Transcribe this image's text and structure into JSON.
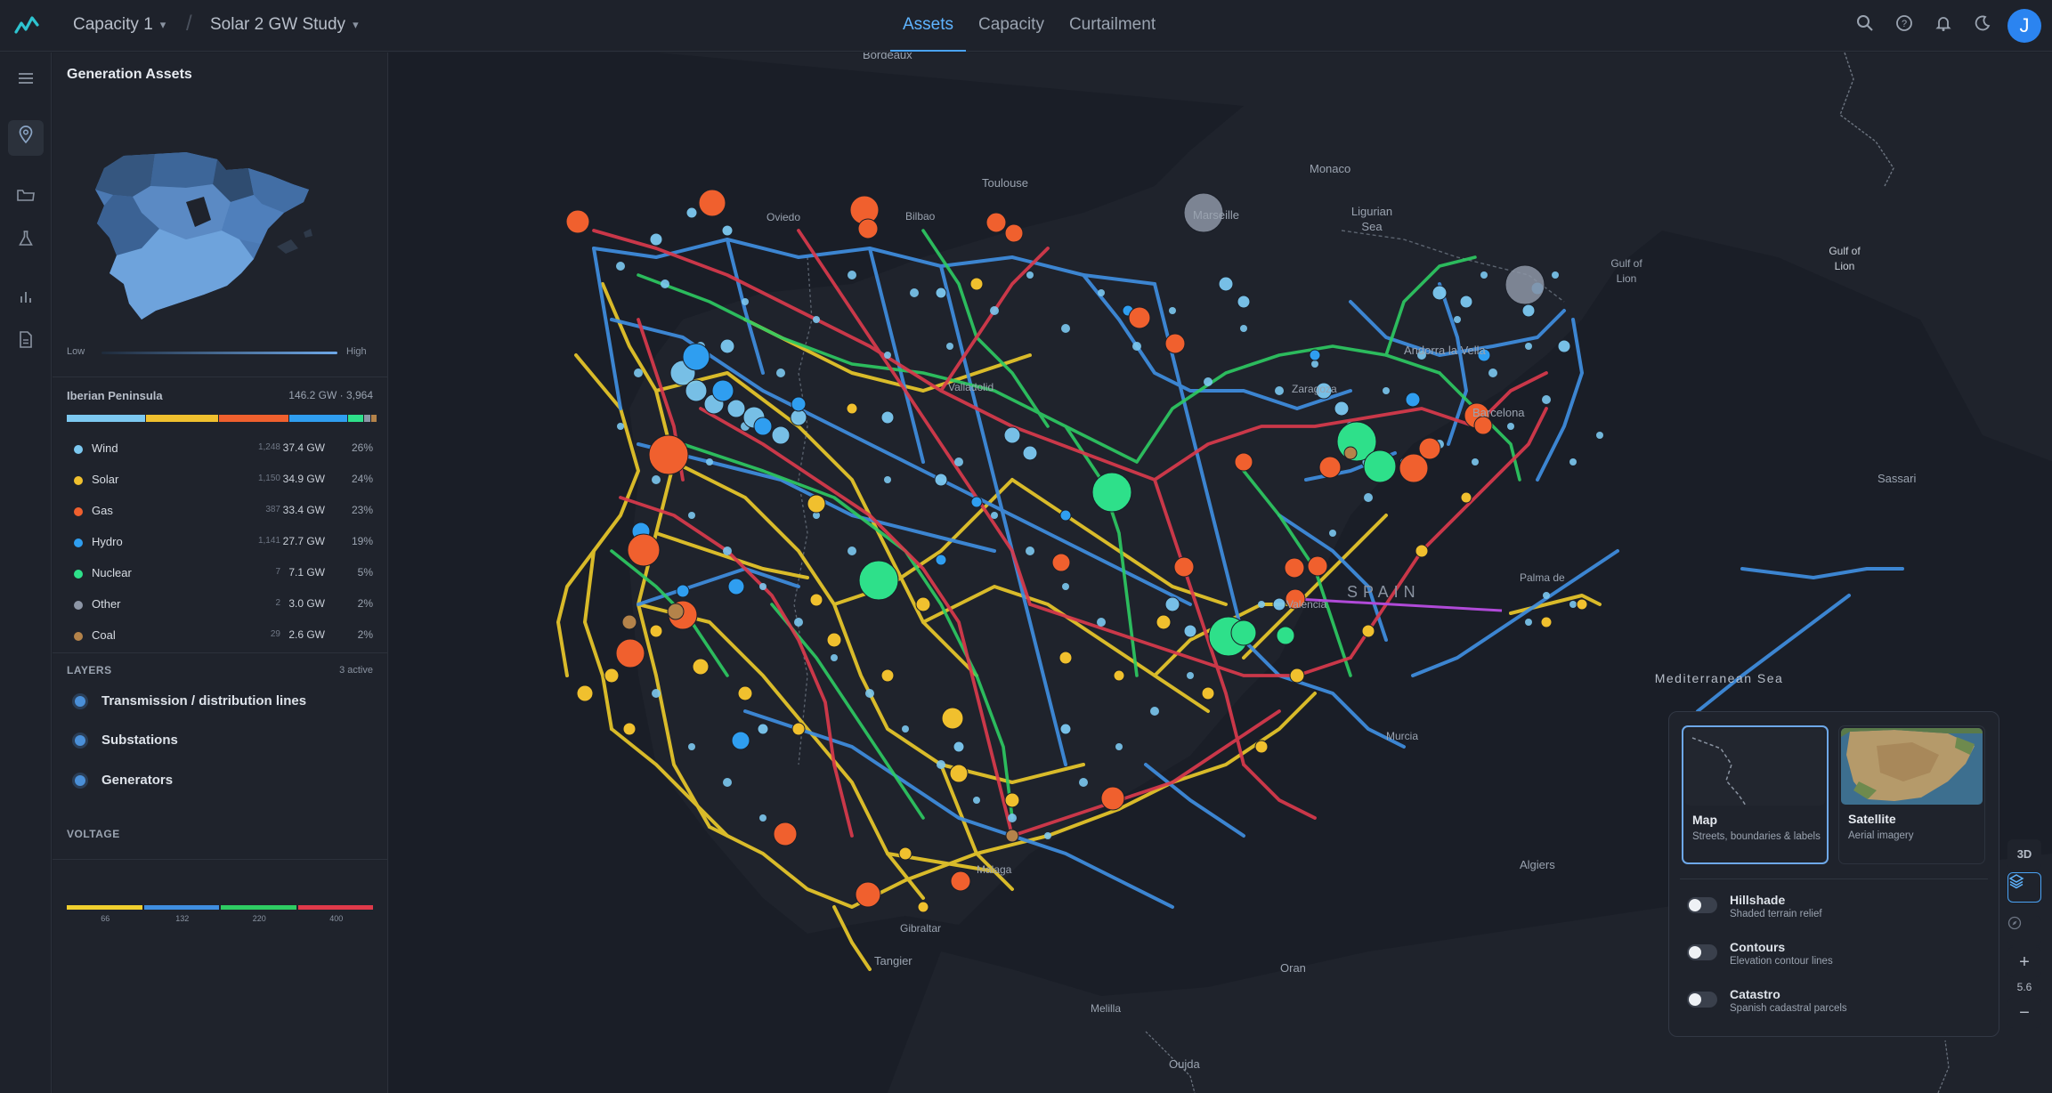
{
  "topbar": {
    "project": "Capacity 1",
    "study": "Solar 2 GW Study",
    "tabs": [
      {
        "label": "Assets",
        "active": true
      },
      {
        "label": "Capacity",
        "active": false
      },
      {
        "label": "Curtailment",
        "active": false
      }
    ],
    "avatar_initial": "J"
  },
  "panel": {
    "title": "Generation Assets",
    "minimap_legend": {
      "low": "Low",
      "high": "High"
    },
    "region": {
      "name": "Iberian Peninsula",
      "total": "146.2 GW · 3,964"
    },
    "fuels": [
      {
        "name": "Wind",
        "count": "1,248",
        "gw": "37.4 GW",
        "pct": "26%",
        "color": "#7cc8f0"
      },
      {
        "name": "Solar",
        "count": "1,150",
        "gw": "34.9 GW",
        "pct": "24%",
        "color": "#f0c02e"
      },
      {
        "name": "Gas",
        "count": "387",
        "gw": "33.4 GW",
        "pct": "23%",
        "color": "#f0602e"
      },
      {
        "name": "Hydro",
        "count": "1,141",
        "gw": "27.7 GW",
        "pct": "19%",
        "color": "#2f9ef0"
      },
      {
        "name": "Nuclear",
        "count": "7",
        "gw": "7.1 GW",
        "pct": "5%",
        "color": "#2ee08a"
      },
      {
        "name": "Other",
        "count": "2",
        "gw": "3.0 GW",
        "pct": "2%",
        "color": "#8d96a6"
      },
      {
        "name": "Coal",
        "count": "29",
        "gw": "2.6 GW",
        "pct": "2%",
        "color": "#b4834a"
      }
    ],
    "layers": {
      "heading": "LAYERS",
      "active": "3 active",
      "items": [
        "Transmission / distribution lines",
        "Substations",
        "Generators"
      ]
    },
    "voltage": {
      "heading": "VOLTAGE",
      "levels": [
        {
          "kv": "66",
          "color": "#f0cf2e"
        },
        {
          "kv": "132",
          "color": "#3f8ee0"
        },
        {
          "kv": "220",
          "color": "#2ecc63"
        },
        {
          "kv": "400",
          "color": "#e03a4a"
        }
      ]
    }
  },
  "map": {
    "places": {
      "bordeaux": "Bordeaux",
      "toulouse": "Toulouse",
      "marseille": "Marseille",
      "monaco": "Monaco",
      "ligurian": "Ligurian Sea",
      "gulf": "Gulf of Lion",
      "andorra": "Andorra la Vella",
      "barcelona": "Barcelona",
      "bilbao": "Bilbao",
      "valladolid": "Valladolid",
      "zaragoza": "Zaragoza",
      "spain": "SPAIN",
      "valencia": "Valencia",
      "palma": "Palma de",
      "sassari": "Sassari",
      "mediterranean": "Mediterranean Sea",
      "algiers": "Algiers",
      "oran": "Oran",
      "malaga": "Malaga",
      "gibraltar": "Gibraltar",
      "tangier": "Tangier",
      "melilla": "Melilla",
      "oujda": "Oujda",
      "oviedo": "Oviedo",
      "murcia": "Murcia"
    },
    "basemap": {
      "options": [
        {
          "title": "Map",
          "subtitle": "Streets, boundaries & labels",
          "selected": true
        },
        {
          "title": "Satellite",
          "subtitle": "Aerial imagery",
          "selected": false
        }
      ],
      "overlays": [
        {
          "title": "Hillshade",
          "subtitle": "Shaded terrain relief",
          "on": false
        },
        {
          "title": "Contours",
          "subtitle": "Elevation contour lines",
          "on": false
        },
        {
          "title": "Catastro",
          "subtitle": "Spanish cadastral parcels",
          "on": false
        }
      ]
    },
    "controls": {
      "mode_3d": "3D",
      "zoom_level": "5.6",
      "zoom_in": "+",
      "zoom_out": "−"
    }
  }
}
